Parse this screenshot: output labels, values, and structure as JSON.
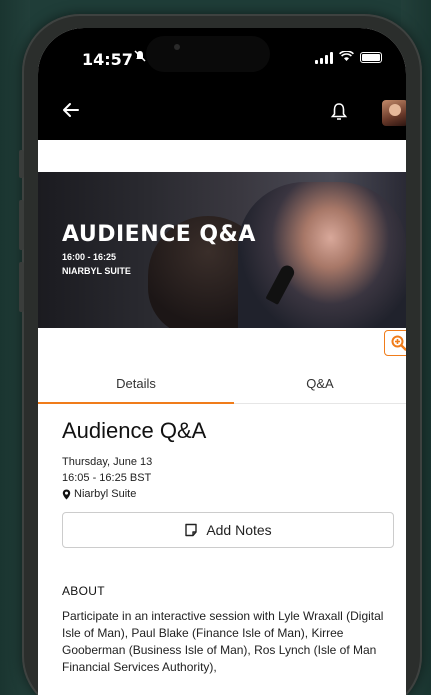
{
  "status_bar": {
    "time": "14:57",
    "colors": {
      "bar": "#000000",
      "text": "#ffffff"
    }
  },
  "header": {
    "back_icon": "arrow-left-icon",
    "bell_icon": "bell-icon",
    "avatar_icon": "avatar"
  },
  "banner": {
    "title": "AUDIENCE Q&A",
    "time": "16:00 - 16:25",
    "room": "NIARBYL SUITE"
  },
  "tabs": [
    {
      "label": "Details",
      "active": true
    },
    {
      "label": "Q&A",
      "active": false
    }
  ],
  "session": {
    "title": "Audience Q&A",
    "date": "Thursday, June 13",
    "time": "16:05 - 16:25 BST",
    "location": "Niarbyl Suite",
    "add_notes_label": "Add Notes"
  },
  "about": {
    "heading": "ABOUT",
    "text": "Participate in an interactive session with Lyle Wraxall (Digital Isle of Man), Paul Blake (Finance Isle of Man), Kirree Gooberman (Business Isle of Man), Ros Lynch (Isle of Man Financial Services Authority),"
  },
  "accent_color": "#f07c1a",
  "background_color": "#1f3d38"
}
